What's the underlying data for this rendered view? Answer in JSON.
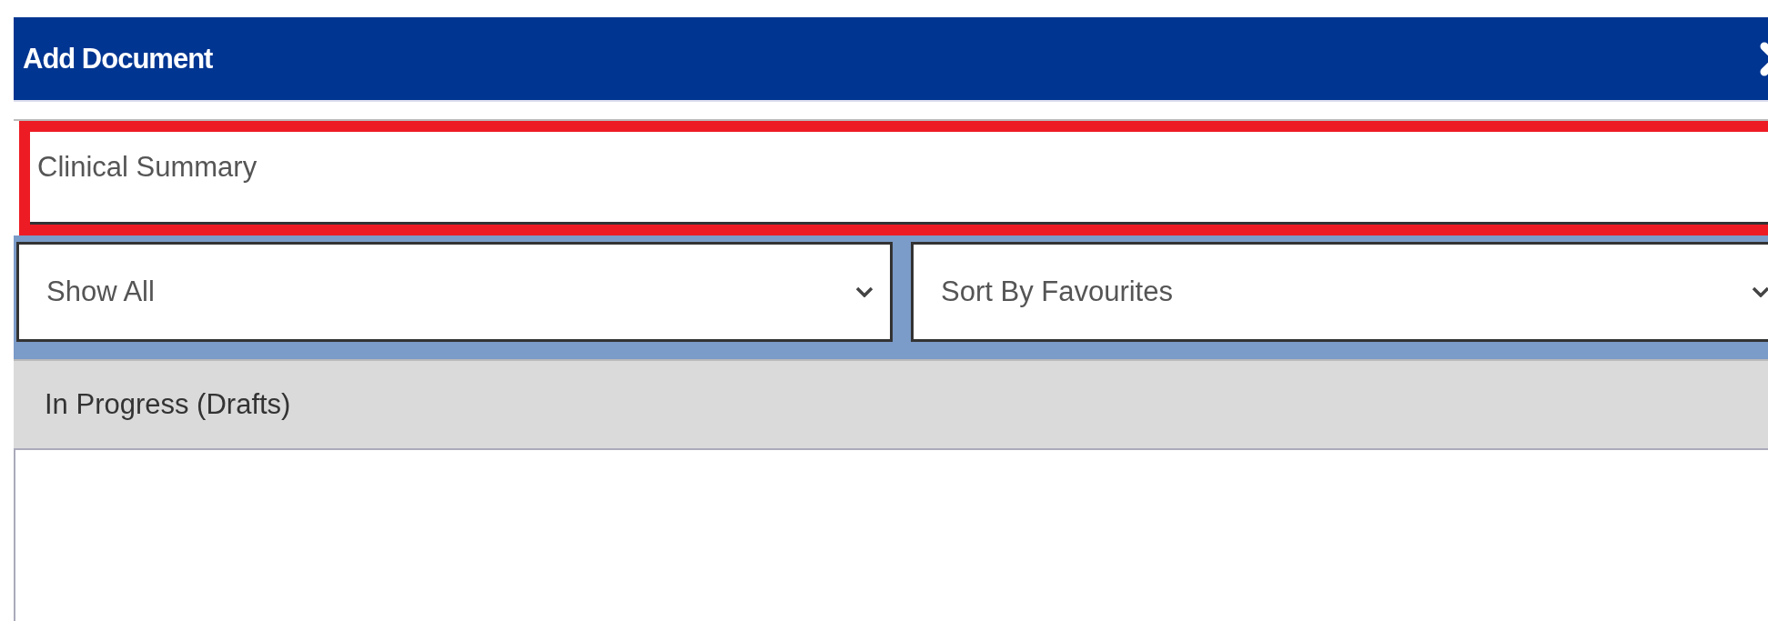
{
  "window": {
    "title": "Add Document"
  },
  "search": {
    "value": "Clinical Summary",
    "highlighted": true
  },
  "filters": [
    {
      "value": "Show All"
    },
    {
      "value": "Sort By Favourites"
    }
  ],
  "section": {
    "title": "In Progress (Drafts)"
  }
}
